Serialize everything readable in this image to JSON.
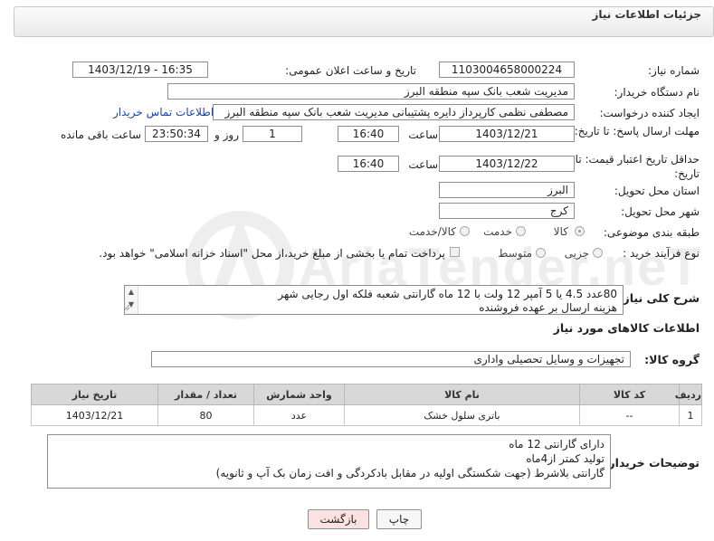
{
  "header": {
    "title": "جزئیات اطلاعات نیاز"
  },
  "watermark": {
    "text": "AriaTender.neT"
  },
  "fields": {
    "need_number": {
      "label": "شماره نیاز:",
      "value": "1103004658000224"
    },
    "announce": {
      "label": "تاریخ و ساعت اعلان عمومی:",
      "value": "1403/12/19 - 16:35"
    },
    "buyer": {
      "label": "نام دستگاه خریدار:",
      "value": "مدیریت شعب بانک سپه منطقه البرز"
    },
    "creator": {
      "label": "ایجاد کننده درخواست:",
      "value": "مصطفی نظمی کارپرداز دایره پشتیبانی مدیریت شعب بانک سپه منطقه البرز",
      "contact_link": "اطلاعات تماس خریدار"
    },
    "deadline": {
      "label": "مهلت ارسال پاسخ: تا تاریخ:",
      "date": "1403/12/21",
      "time_label": "ساعت",
      "time": "16:40",
      "days": "1",
      "days_label": "روز و",
      "remaining": "23:50:34",
      "remaining_label": "ساعت باقی مانده"
    },
    "validity": {
      "label": "حداقل تاریخ اعتبار قیمت: تا تاریخ:",
      "date": "1403/12/22",
      "time_label": "ساعت",
      "time": "16:40"
    },
    "province": {
      "label": "استان محل تحویل:",
      "value": "البرز"
    },
    "city": {
      "label": "شهر محل تحویل:",
      "value": "کرج"
    },
    "category": {
      "label": "طبقه بندی موضوعی:",
      "options": [
        "کالا",
        "خدمت",
        "کالا/خدمت"
      ],
      "selected": "کالا"
    },
    "process": {
      "label": "نوع فرآیند خرید :",
      "options": [
        "جزیی",
        "متوسط"
      ],
      "payment_note": "پرداخت تمام یا بخشی از مبلغ خرید،از محل \"اسناد خزانه اسلامی\" خواهد بود."
    },
    "description": {
      "label": "شرح کلی نیاز:",
      "lines": [
        "80عدد 4.5 یا 5 آمپر 12 ولت با 12 ماه گارانتی شعبه فلکه اول رجایی شهر",
        "هزینه ارسال بر عهده فروشنده"
      ]
    }
  },
  "goods": {
    "section_title": "اطلاعات کالاهای مورد نیاز",
    "group_label": "گروه کالا:",
    "group_value": "تجهیزات و وسایل تحصیلی واداری",
    "columns": [
      "ردیف",
      "کد کالا",
      "نام کالا",
      "واحد شمارش",
      "تعداد / مقدار",
      "تاریخ نیاز"
    ],
    "rows": [
      {
        "index": "1",
        "code": "--",
        "name": "باتری سلول خشک",
        "unit": "عدد",
        "qty": "80",
        "date": "1403/12/21"
      }
    ]
  },
  "buyer_notes": {
    "label": "توضیحات خریدار:",
    "lines": [
      "دارای گارانتی 12 ماه",
      "تولید کمتر از4ماه",
      "گارانتی بلاشرط (جهت شکستگی اولیه در مقابل بادکردگی و افت زمان بک آپ و ثانویه)"
    ]
  },
  "buttons": {
    "print": "چاپ",
    "back": "بازگشت"
  },
  "colors": {
    "back_button_bg": "#fbe1e1",
    "link": "#1a44b4",
    "header_bg": "#eeeeee"
  }
}
